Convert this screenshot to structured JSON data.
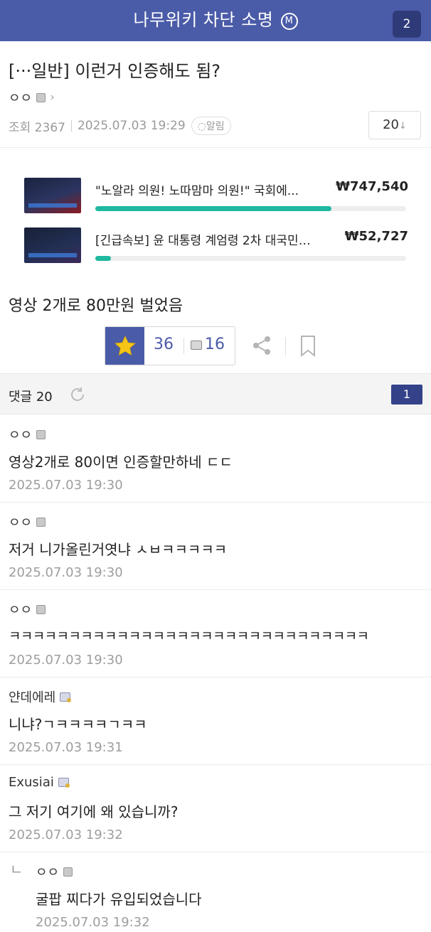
{
  "topbar": {
    "title": "나무위키 차단 소명",
    "mark": "M",
    "badge": "2"
  },
  "post": {
    "title": "[···일반] 이런거 인증해도 됨?",
    "author": "ㅇㅇ",
    "views": "조회 2367",
    "datetime": "2025.07.03 19:29",
    "alarm": "알림",
    "comment_count": "20",
    "body": "영상 2개로 80만원 벌었음"
  },
  "ads": [
    {
      "title": "\"노알라 의원! 노따맘마 의원!\" 국회에...",
      "price": "₩747,540",
      "progress": 0.76
    },
    {
      "title": "[긴급속보] 윤 대통령 계엄령 2차 대국민…",
      "price": "₩52,727",
      "progress": 0.05
    }
  ],
  "votes": {
    "up": "36",
    "sub": "16"
  },
  "comments_header": {
    "label": "댓글 20",
    "page": "1"
  },
  "comments": [
    {
      "name": "ㅇㅇ",
      "text": "영상2개로 80이면 인증할만하네 ㄷㄷ",
      "time": "2025.07.03 19:30"
    },
    {
      "name": "ㅇㅇ",
      "text": "저거 니가올린거엿냐 ㅅㅂㅋㅋㅋㅋㅋ",
      "time": "2025.07.03 19:30"
    },
    {
      "name": "ㅇㅇ",
      "text": "ㅋㅋㅋㅋㅋㅋㅋㅋㅋㅋㅋㅋㅋㅋㅋㅋㅋㅋㅋㅋㅋㅋㅋㅋㅋㅋㅋㅋㅋㅋ",
      "time": "2025.07.03 19:30"
    },
    {
      "name": "얀데에레",
      "text": "니냐?ㄱㅋㅋㅋㅋㄱㅋㅋ",
      "time": "2025.07.03 19:31"
    },
    {
      "name": "Exusiai",
      "text": "그 저기 여기에 왜 있습니까?",
      "time": "2025.07.03 19:32"
    },
    {
      "name": "ㅇㅇ",
      "text": "굴팝 찌다가 유입되었습니다",
      "time": "2025.07.03 19:32",
      "reply_mark": "ㄴ"
    }
  ],
  "colors": {
    "brand": "#4a5ba8",
    "progress": "#1fb8a0",
    "star": "#f5c518"
  }
}
